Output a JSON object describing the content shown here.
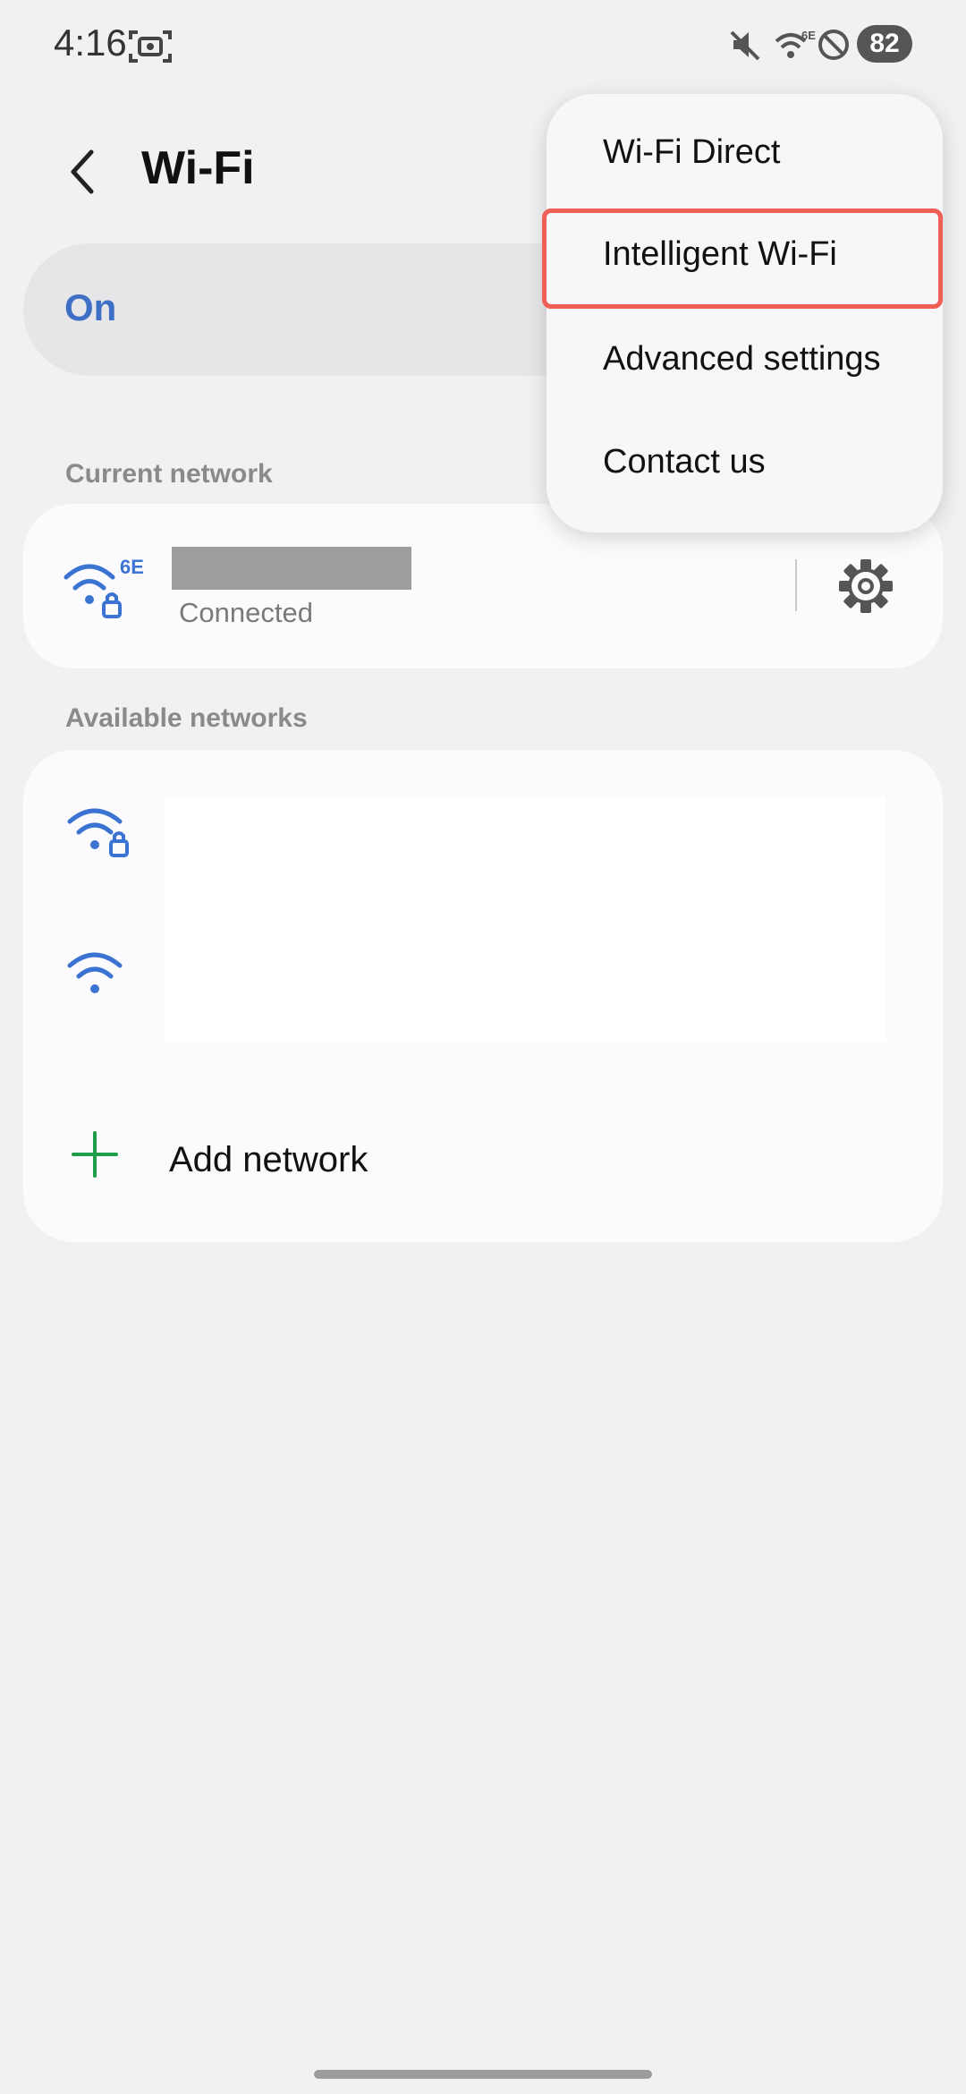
{
  "status_bar": {
    "time": "4:16",
    "battery": "82",
    "icons": [
      "screenshot-icon",
      "mute-icon",
      "wifi-6e-icon",
      "do-not-disturb-icon"
    ]
  },
  "header": {
    "title": "Wi-Fi",
    "back_icon": "chevron-left-icon"
  },
  "toggle": {
    "label": "On"
  },
  "current_network": {
    "section_title": "Current network",
    "status": "Connected",
    "icon": "wifi-6e-lock-icon",
    "settings_icon": "gear-icon"
  },
  "available_networks": {
    "section_title": "Available networks",
    "network_icons": [
      "wifi-lock-icon",
      "wifi-icon"
    ],
    "add_label": "Add network",
    "add_icon": "plus-icon"
  },
  "menu": {
    "items": [
      {
        "label": "Wi-Fi Direct"
      },
      {
        "label": "Intelligent Wi-Fi"
      },
      {
        "label": "Advanced settings"
      },
      {
        "label": "Contact us"
      }
    ],
    "highlighted_index": 1
  },
  "colors": {
    "accent_blue": "#3d6fc6",
    "wifi_icon_blue": "#3b73d2",
    "add_green": "#1e9e48",
    "highlight_red": "#ef5f55"
  }
}
